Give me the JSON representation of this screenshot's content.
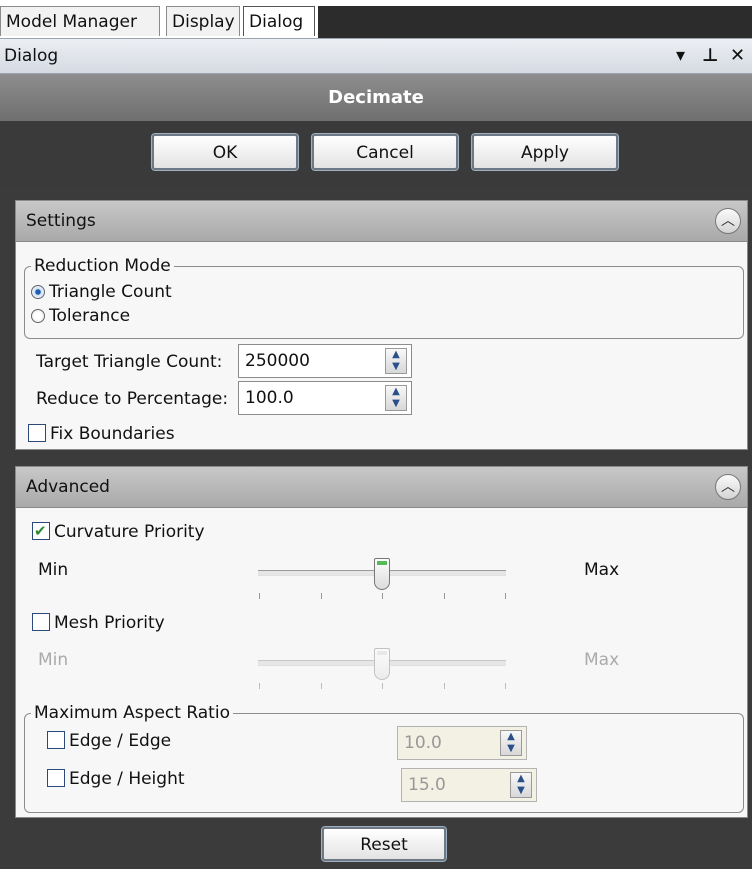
{
  "tabs": [
    "Model Manager",
    "Display",
    "Dialog"
  ],
  "active_tab": "Dialog",
  "caption": {
    "title": "Dialog",
    "dropdown_icon": "dropdown-arrow-icon",
    "pin_icon": "pin-icon",
    "close_icon": "close-icon"
  },
  "header": {
    "title": "Decimate"
  },
  "actions": {
    "ok": "OK",
    "cancel": "Cancel",
    "apply": "Apply",
    "reset": "Reset"
  },
  "settings": {
    "title": "Settings",
    "reduction_mode": {
      "legend": "Reduction Mode",
      "options": [
        "Triangle Count",
        "Tolerance"
      ],
      "selected": "Triangle Count"
    },
    "target_triangle_count": {
      "label": "Target Triangle Count:",
      "value": "250000"
    },
    "reduce_to_percentage": {
      "label": "Reduce to Percentage:",
      "value": "100.0"
    },
    "fix_boundaries": {
      "label": "Fix Boundaries",
      "checked": false
    }
  },
  "advanced": {
    "title": "Advanced",
    "curvature_priority": {
      "label": "Curvature Priority",
      "checked": true,
      "min": "Min",
      "max": "Max",
      "level": 0.5
    },
    "mesh_priority": {
      "label": "Mesh Priority",
      "checked": false,
      "min": "Min",
      "max": "Max",
      "level": 0.5
    },
    "max_aspect_ratio": {
      "legend": "Maximum Aspect Ratio",
      "edge_edge": {
        "label": "Edge / Edge",
        "checked": false,
        "value": "10.0"
      },
      "edge_height": {
        "label": "Edge / Height",
        "checked": false,
        "value": "15.0"
      }
    }
  },
  "colors": {
    "header_bg": "#7f7f7f",
    "dark_bg": "#3b3b3b",
    "check_green": "#2e8a2e",
    "thumb_green": "#57b957"
  }
}
